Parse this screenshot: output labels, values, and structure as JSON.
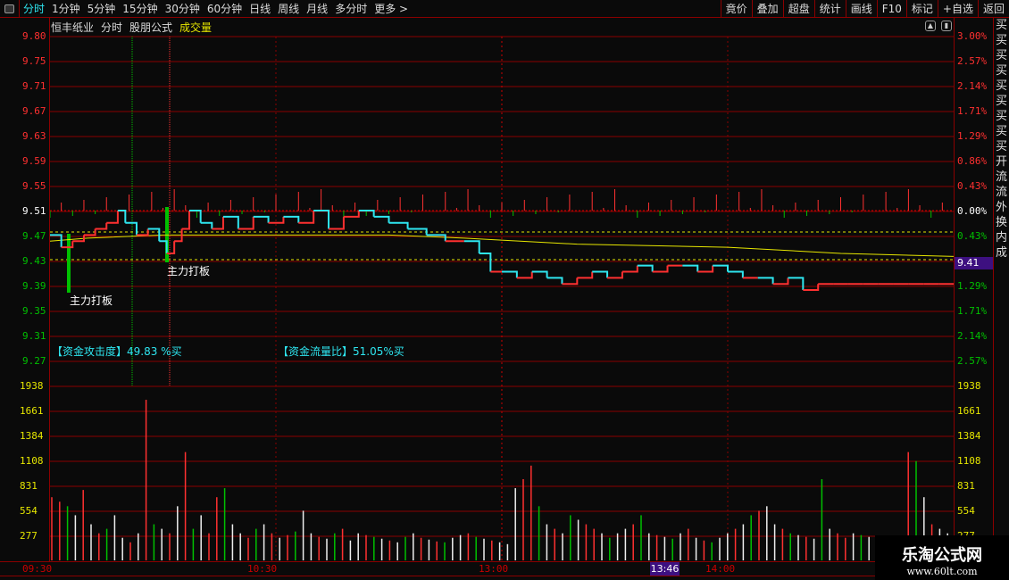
{
  "topbar": {
    "tabs": [
      "分时",
      "1分钟",
      "5分钟",
      "15分钟",
      "30分钟",
      "60分钟",
      "日线",
      "周线",
      "月线",
      "多分时",
      "更多 >"
    ],
    "active": 0,
    "right_tabs": [
      "竟价",
      "叠加",
      "超盘",
      "统计",
      "画线",
      "F10",
      "标记",
      "+自选",
      "返回"
    ]
  },
  "title": {
    "stock": "恒丰纸业",
    "mode": "分时",
    "formula": "股朋公式",
    "indicator": "成交量"
  },
  "price_axis": {
    "labels": [
      "9.80",
      "9.75",
      "9.71",
      "9.67",
      "9.63",
      "9.59",
      "9.55",
      "9.51",
      "9.47",
      "9.43",
      "9.39",
      "9.35",
      "9.31",
      "9.27"
    ],
    "pct": [
      "3.00%",
      "2.57%",
      "2.14%",
      "1.71%",
      "1.29%",
      "0.86%",
      "0.43%",
      "0.00%",
      "0.43%",
      "",
      "1.29%",
      "1.71%",
      "2.14%",
      "2.57%"
    ],
    "current_price": "9.41"
  },
  "volume_axis": {
    "labels": [
      "1938",
      "1661",
      "1384",
      "1108",
      "831",
      "554",
      "277"
    ]
  },
  "time_axis": {
    "labels": [
      "09:30",
      "10:30",
      "13:00",
      "14:00"
    ],
    "cursor": "13:46"
  },
  "annotations": {
    "board1": "主力打板",
    "board2": "主力打板",
    "attack": "【资金攻击度】49.83 %买",
    "flow": "【资金流量比】51.05%买"
  },
  "right_strip": "买买买买买买买买买开流流外换内成",
  "watermark": {
    "title": "乐淘公式网",
    "url": "www.60lt.com"
  },
  "colors": {
    "up": "#ff3030",
    "down": "#00c000",
    "price": "#2ee6f0",
    "avg": "#e6e600",
    "grid": "#8b0000"
  },
  "chart_data": {
    "type": "line",
    "price_series": [
      [
        0,
        9.47
      ],
      [
        3,
        9.45
      ],
      [
        6,
        9.46
      ],
      [
        9,
        9.47
      ],
      [
        12,
        9.48
      ],
      [
        15,
        9.49
      ],
      [
        18,
        9.51
      ],
      [
        20,
        9.49
      ],
      [
        23,
        9.47
      ],
      [
        26,
        9.48
      ],
      [
        29,
        9.46
      ],
      [
        31,
        9.44
      ],
      [
        33,
        9.46
      ],
      [
        35,
        9.48
      ],
      [
        37,
        9.51
      ],
      [
        40,
        9.49
      ],
      [
        43,
        9.48
      ],
      [
        46,
        9.5
      ],
      [
        50,
        9.48
      ],
      [
        54,
        9.5
      ],
      [
        58,
        9.49
      ],
      [
        62,
        9.5
      ],
      [
        66,
        9.49
      ],
      [
        70,
        9.51
      ],
      [
        74,
        9.48
      ],
      [
        78,
        9.5
      ],
      [
        82,
        9.51
      ],
      [
        86,
        9.5
      ],
      [
        90,
        9.49
      ],
      [
        95,
        9.48
      ],
      [
        100,
        9.47
      ],
      [
        105,
        9.46
      ],
      [
        110,
        9.46
      ],
      [
        114,
        9.44
      ],
      [
        117,
        9.41
      ],
      [
        120,
        9.41
      ],
      [
        124,
        9.4
      ],
      [
        128,
        9.41
      ],
      [
        132,
        9.4
      ],
      [
        136,
        9.39
      ],
      [
        140,
        9.4
      ],
      [
        144,
        9.41
      ],
      [
        148,
        9.4
      ],
      [
        152,
        9.41
      ],
      [
        156,
        9.42
      ],
      [
        160,
        9.41
      ],
      [
        164,
        9.42
      ],
      [
        168,
        9.42
      ],
      [
        172,
        9.41
      ],
      [
        176,
        9.42
      ],
      [
        180,
        9.41
      ],
      [
        184,
        9.4
      ],
      [
        188,
        9.4
      ],
      [
        192,
        9.39
      ],
      [
        196,
        9.4
      ],
      [
        200,
        9.38
      ],
      [
        204,
        9.39
      ],
      [
        208,
        9.39
      ],
      [
        212,
        9.39
      ],
      [
        216,
        9.39
      ],
      [
        220,
        9.39
      ],
      [
        224,
        9.39
      ],
      [
        228,
        9.39
      ],
      [
        232,
        9.39
      ],
      [
        236,
        9.39
      ],
      [
        240,
        9.39
      ]
    ],
    "avg_series": [
      [
        0,
        9.46
      ],
      [
        10,
        9.465
      ],
      [
        30,
        9.47
      ],
      [
        60,
        9.47
      ],
      [
        90,
        9.47
      ],
      [
        110,
        9.465
      ],
      [
        140,
        9.455
      ],
      [
        180,
        9.45
      ],
      [
        210,
        9.44
      ],
      [
        240,
        9.435
      ]
    ],
    "volume": [
      700,
      650,
      600,
      500,
      780,
      400,
      300,
      350,
      500,
      250,
      200,
      300,
      1780,
      400,
      350,
      300,
      600,
      1200,
      350,
      500,
      300,
      700,
      800,
      400,
      300,
      250,
      350,
      400,
      300,
      250,
      280,
      320,
      550,
      300,
      260,
      240,
      300,
      350,
      220,
      300,
      280,
      260,
      240,
      220,
      200,
      260,
      300,
      250,
      230,
      210,
      200,
      250,
      280,
      300,
      260,
      240,
      220,
      200,
      180,
      800,
      900,
      1050,
      600,
      400,
      350,
      300,
      500,
      450,
      400,
      350,
      300,
      250,
      300,
      350,
      400,
      500,
      300,
      280,
      260,
      240,
      300,
      350,
      250,
      220,
      200,
      250,
      300,
      350,
      400,
      500,
      550,
      600,
      400,
      350,
      300,
      280,
      260,
      240,
      900,
      350,
      300,
      250,
      300,
      280,
      260,
      240,
      220,
      200,
      250,
      1200,
      1100,
      700,
      400,
      350,
      300
    ],
    "volume_colors": "rrgwrwrgwwrwrgwrwrgwrrgwwrgwrwrgwwrwgrwwrgwrwgwrwrgwwrgwrwwwrrgwrwgwrrwgwwrgwrwgwrwrgwwrwgrwwrgwrwgwrrwgwwrgwrgwrww",
    "ylim_price": [
      9.27,
      9.8
    ],
    "ylim_volume": [
      0,
      1938
    ],
    "x_range_minutes": [
      0,
      240
    ]
  }
}
